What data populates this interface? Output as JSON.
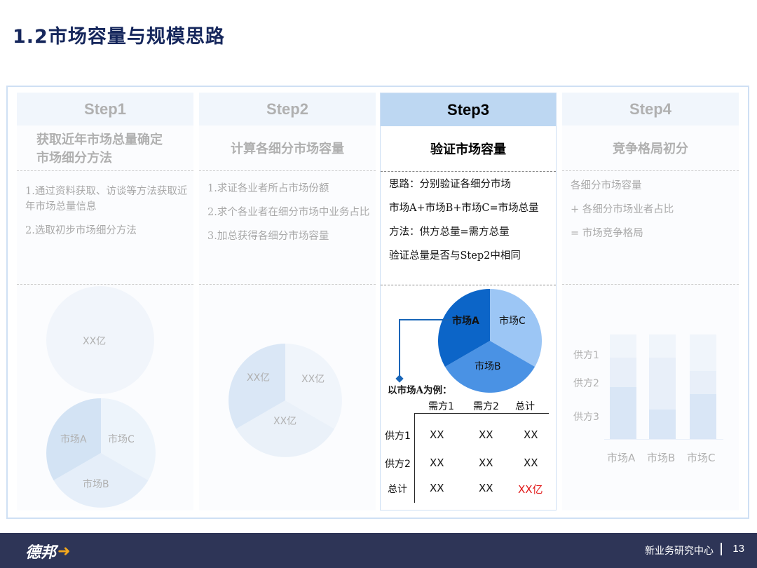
{
  "title": "1.2市场容量与规模思路",
  "steps": [
    {
      "label": "Step1",
      "subtitle": "获取近年市场总量确定市场细分方法",
      "desc": [
        "1.通过资料获取、访谈等方法获取近年市场总量信息",
        "2.选取初步市场细分方法"
      ],
      "pie_top_label": "XX亿",
      "pie_labels": [
        "市场A",
        "市场C",
        "市场B"
      ]
    },
    {
      "label": "Step2",
      "subtitle": "计算各细分市场容量",
      "desc": [
        "1.求证各业者所占市场份额",
        "2.求个各业者在细分市场中业务占比",
        "3.加总获得各细分市场容量"
      ],
      "pie_labels": [
        "XX亿",
        "XX亿",
        "XX亿"
      ]
    },
    {
      "label": "Step3",
      "subtitle": "验证市场容量",
      "desc": [
        "思路：分别验证各细分市场",
        "市场A+市场B+市场C=市场总量",
        "方法：供方总量=需方总量",
        "验证总量是否与Step2中相同"
      ],
      "pie_labels": [
        "市场A",
        "市场C",
        "市场B"
      ],
      "example_label": "以市场A为例：",
      "table": {
        "col_headers": [
          "需方1",
          "需方2",
          "总计"
        ],
        "rows": [
          {
            "label": "供方1",
            "cells": [
              "XX",
              "XX",
              "XX"
            ]
          },
          {
            "label": "供方2",
            "cells": [
              "XX",
              "XX",
              "XX"
            ]
          },
          {
            "label": "总计",
            "cells": [
              "XX",
              "XX",
              "XX亿"
            ]
          }
        ]
      }
    },
    {
      "label": "Step4",
      "subtitle": "竞争格局初分",
      "desc": [
        "各细分市场容量",
        "+ 各细分市场业者占比",
        "= 市场竞争格局"
      ],
      "bar_row_labels": [
        "供方1",
        "供方2",
        "供方3"
      ],
      "bar_categories": [
        "市场A",
        "市场B",
        "市场C"
      ]
    }
  ],
  "colors": {
    "title": "#16275c",
    "step_header": "#deebf8",
    "step_header_active": "#bdd7f2",
    "pie_dark": "#0c65c8",
    "pie_mid": "#4a92e4",
    "pie_light": "#9cc6f5",
    "highlight": "#e21c1c",
    "footer": "#2e3557"
  },
  "footer": {
    "logo": "德邦",
    "center": "新业务研究中心",
    "page": "13"
  }
}
